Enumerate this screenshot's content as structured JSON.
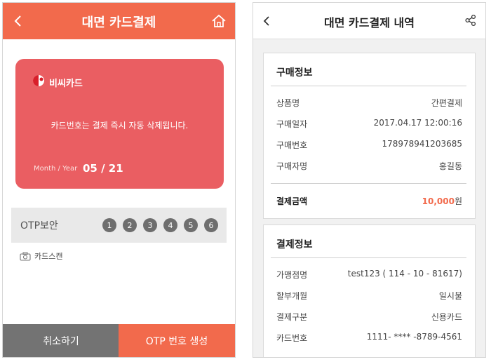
{
  "left": {
    "header": {
      "title": "대면 카드결제"
    },
    "card": {
      "brand": "비씨카드",
      "notice": "카드번호는 결제 즉시 자동 삭제됩니다.",
      "expiry_label": "Month / Year",
      "expiry_value": "05 / 21"
    },
    "otp": {
      "label": "OTP보안",
      "digits": [
        "1",
        "2",
        "3",
        "4",
        "5",
        "6"
      ]
    },
    "scan": {
      "label": "카드스캔"
    },
    "buttons": {
      "cancel": "취소하기",
      "generate": "OTP 번호 생성"
    },
    "colors": {
      "accent": "#f26a4c",
      "card": "#ea5e62",
      "cancel": "#737373"
    }
  },
  "right": {
    "header": {
      "title": "대면 카드결제 내역"
    },
    "purchase": {
      "title": "구매정보",
      "rows": [
        {
          "key": "상품명",
          "value": "간편결제"
        },
        {
          "key": "구매일자",
          "value": "2017.04.17 12:00:16"
        },
        {
          "key": "구매번호",
          "value": "178978941203685"
        },
        {
          "key": "구매자명",
          "value": "홍길동"
        }
      ],
      "total_label": "결제금액",
      "total_amount": "10,000",
      "total_unit": "원"
    },
    "payment": {
      "title": "결제정보",
      "rows": [
        {
          "key": "가맹점명",
          "value": "test123 ( 114 - 10 - 81617)"
        },
        {
          "key": "할부개월",
          "value": "일시불"
        },
        {
          "key": "결제구분",
          "value": "신용카드"
        },
        {
          "key": "카드번호",
          "value": "1111- **** -8789-4561"
        }
      ]
    }
  }
}
